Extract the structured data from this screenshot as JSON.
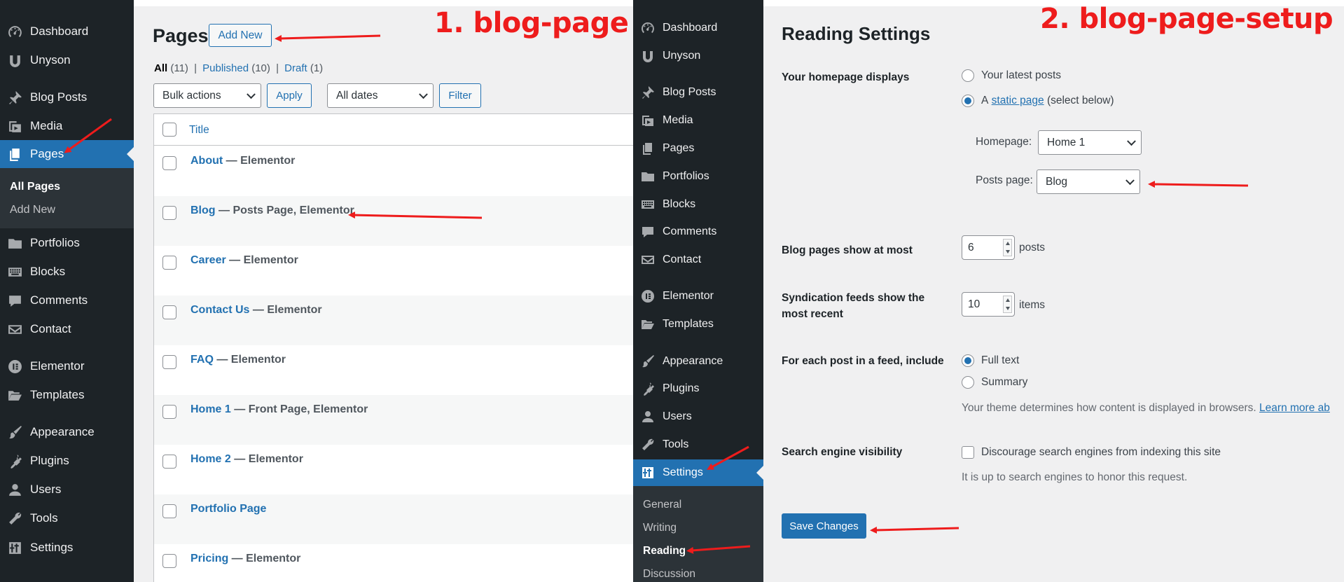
{
  "left_menu": {
    "items": [
      {
        "label": "Dashboard",
        "icon": "dashboard-icon"
      },
      {
        "label": "Unyson",
        "icon": "unyson-icon"
      },
      {
        "label": "Blog Posts",
        "icon": "pin-icon"
      },
      {
        "label": "Media",
        "icon": "media-icon"
      },
      {
        "label": "Pages",
        "icon": "pages-icon"
      },
      {
        "label": "Portfolios",
        "icon": "folder-icon"
      },
      {
        "label": "Blocks",
        "icon": "keyboard-icon"
      },
      {
        "label": "Comments",
        "icon": "comment-icon"
      },
      {
        "label": "Contact",
        "icon": "mail-icon"
      },
      {
        "label": "Elementor",
        "icon": "elementor-icon"
      },
      {
        "label": "Templates",
        "icon": "folder-open-icon"
      },
      {
        "label": "Appearance",
        "icon": "brush-icon"
      },
      {
        "label": "Plugins",
        "icon": "plug-icon"
      },
      {
        "label": "Users",
        "icon": "user-icon"
      },
      {
        "label": "Tools",
        "icon": "wrench-icon"
      },
      {
        "label": "Settings",
        "icon": "settings-icon"
      }
    ],
    "submenu": [
      "All Pages",
      "Add New"
    ]
  },
  "pages_screen": {
    "title": "Pages",
    "add_new": "Add New",
    "filters": {
      "all": "All",
      "all_count": "(11)",
      "published": "Published",
      "published_count": "(10)",
      "draft": "Draft",
      "draft_count": "(1)",
      "separator": "|"
    },
    "bulk_actions": "Bulk actions",
    "apply": "Apply",
    "all_dates": "All dates",
    "filter": "Filter",
    "column_title": "Title",
    "rows": [
      {
        "title": "About",
        "state": " — Elementor"
      },
      {
        "title": "Blog",
        "state": " — Posts Page, Elementor"
      },
      {
        "title": "Career",
        "state": " — Elementor"
      },
      {
        "title": "Contact Us",
        "state": " — Elementor"
      },
      {
        "title": "FAQ",
        "state": " — Elementor"
      },
      {
        "title": "Home 1",
        "state": " — Front Page, Elementor"
      },
      {
        "title": "Home 2",
        "state": " — Elementor"
      },
      {
        "title": "Portfolio Page",
        "state": ""
      },
      {
        "title": "Pricing",
        "state": " — Elementor"
      }
    ]
  },
  "middle_menu": {
    "items": [
      {
        "label": "Dashboard",
        "icon": "dashboard-icon"
      },
      {
        "label": "Unyson",
        "icon": "unyson-icon"
      },
      {
        "label": "Blog Posts",
        "icon": "pin-icon"
      },
      {
        "label": "Media",
        "icon": "media-icon"
      },
      {
        "label": "Pages",
        "icon": "pages-icon"
      },
      {
        "label": "Portfolios",
        "icon": "folder-icon"
      },
      {
        "label": "Blocks",
        "icon": "keyboard-icon"
      },
      {
        "label": "Comments",
        "icon": "comment-icon"
      },
      {
        "label": "Contact",
        "icon": "mail-icon"
      },
      {
        "label": "Elementor",
        "icon": "elementor-icon"
      },
      {
        "label": "Templates",
        "icon": "folder-open-icon"
      },
      {
        "label": "Appearance",
        "icon": "brush-icon"
      },
      {
        "label": "Plugins",
        "icon": "plug-icon"
      },
      {
        "label": "Users",
        "icon": "user-icon"
      },
      {
        "label": "Tools",
        "icon": "wrench-icon"
      },
      {
        "label": "Settings",
        "icon": "settings-icon"
      }
    ],
    "submenu": [
      "General",
      "Writing",
      "Reading",
      "Discussion"
    ]
  },
  "reading_settings": {
    "title": "Reading Settings",
    "homepage_displays": {
      "label": "Your homepage displays",
      "latest_posts": "Your latest posts",
      "static_prefix": "A",
      "static_link": "static page",
      "static_suffix": "(select below)",
      "homepage_label": "Homepage:",
      "homepage_value": "Home 1",
      "posts_page_label": "Posts page:",
      "posts_page_value": "Blog"
    },
    "blog_pages": {
      "label": "Blog pages show at most",
      "value": "6",
      "unit": "posts"
    },
    "syndication": {
      "label_line1": "Syndication feeds show the",
      "label_line2": "most recent",
      "value": "10",
      "unit": "items"
    },
    "feed_include": {
      "label": "For each post in a feed, include",
      "full_text": "Full text",
      "summary": "Summary",
      "description": "Your theme determines how content is displayed in browsers.",
      "learn_more": "Learn more ab"
    },
    "search_visibility": {
      "label": "Search engine visibility",
      "checkbox_label": "Discourage search engines from indexing this site",
      "description": "It is up to search engines to honor this request."
    },
    "save": "Save Changes"
  },
  "annotations": {
    "step1": "1. blog-page",
    "step2": "2. blog-page-setup",
    "color": "#ee1c1c"
  },
  "colors": {
    "admin_bar": "#1d2327",
    "accent": "#2271b1",
    "panel_bg": "#f0f0f1"
  }
}
